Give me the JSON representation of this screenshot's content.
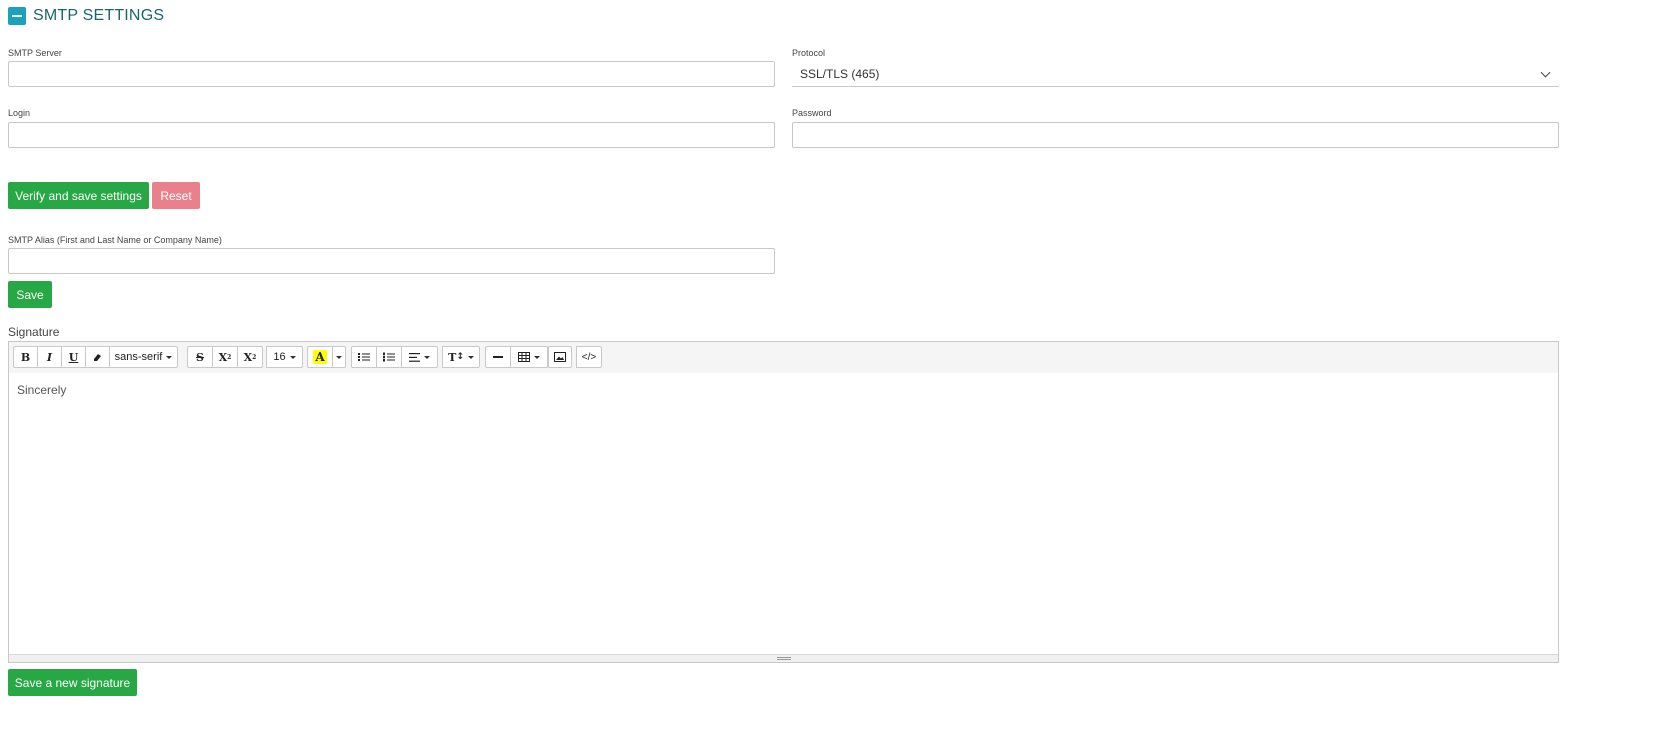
{
  "section": {
    "title": "SMTP SETTINGS"
  },
  "fields": {
    "smtp_server": {
      "label": "SMTP Server",
      "value": ""
    },
    "protocol": {
      "label": "Protocol",
      "value": "SSL/TLS (465)"
    },
    "login": {
      "label": "Login",
      "value": ""
    },
    "password": {
      "label": "Password",
      "value": ""
    },
    "alias": {
      "label": "SMTP Alias (First and Last Name or Company Name)",
      "value": ""
    }
  },
  "buttons": {
    "verify_save": "Verify and save settings",
    "reset": "Reset",
    "save": "Save",
    "save_signature": "Save a new signature"
  },
  "signature": {
    "label": "Signature",
    "content": "Sincerely"
  },
  "toolbar": {
    "font_name": "sans-serif",
    "font_size": "16",
    "bold": "B",
    "italic": "I",
    "underline": "U",
    "superscript": "X",
    "subscript": "X",
    "color_letter": "A",
    "line_height": "T",
    "code": "</>"
  },
  "colors": {
    "accent": "#1aa3b8",
    "success": "#28a745",
    "danger": "#e8818c",
    "highlight": "#ffff00"
  }
}
